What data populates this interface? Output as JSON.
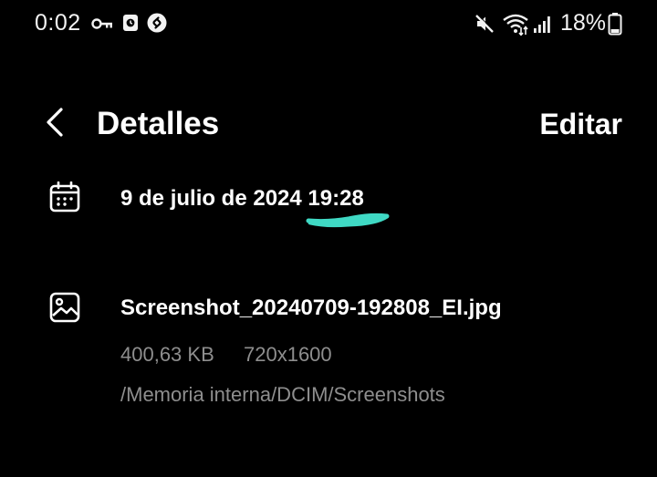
{
  "status_bar": {
    "time": "0:02",
    "battery": "18%",
    "icons": [
      "key-icon",
      "clock-app-icon",
      "shazam-icon",
      "mute-icon",
      "wifi-icon",
      "signal-icon",
      "battery-icon"
    ]
  },
  "header": {
    "title": "Detalles",
    "edit_label": "Editar",
    "back_icon": "chevron-left-icon"
  },
  "details": {
    "date": {
      "icon": "calendar-icon",
      "text": "9 de julio de 2024 19:28"
    },
    "file": {
      "icon": "image-icon",
      "name": "Screenshot_20240709-192808_EI.jpg",
      "size": "400,63 KB",
      "resolution": "720x1600",
      "path": "/Memoria interna/DCIM/Screenshots"
    }
  },
  "colors": {
    "background": "#000000",
    "text": "#ffffff",
    "secondary_text": "#8e8e8e",
    "highlight": "#3fd9c4"
  }
}
